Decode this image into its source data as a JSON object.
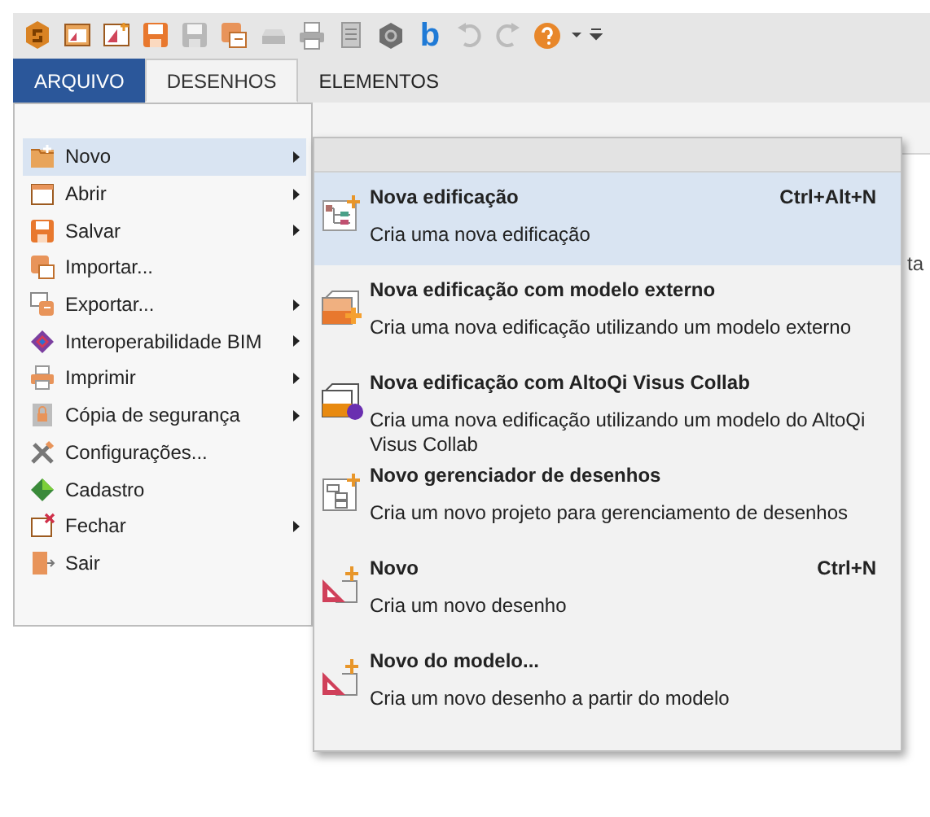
{
  "toolbar": {
    "text_button": "b"
  },
  "tabs": [
    {
      "label": "ARQUIVO",
      "kind": "file",
      "selected": false
    },
    {
      "label": "DESENHOS",
      "kind": "tab",
      "selected": true
    },
    {
      "label": "ELEMENTOS",
      "kind": "tab",
      "selected": false
    }
  ],
  "background_fragment": "ta",
  "file_menu": {
    "items": [
      {
        "label": "Novo",
        "submenu": true,
        "selected": true
      },
      {
        "label": "Abrir",
        "submenu": true,
        "selected": false
      },
      {
        "label": "Salvar",
        "submenu": true,
        "selected": false
      },
      {
        "label": "Importar...",
        "submenu": false,
        "selected": false
      },
      {
        "label": "Exportar...",
        "submenu": true,
        "selected": false
      },
      {
        "label": "Interoperabilidade BIM",
        "submenu": true,
        "selected": false
      },
      {
        "label": "Imprimir",
        "submenu": true,
        "selected": false
      },
      {
        "label": "Cópia de segurança",
        "submenu": true,
        "selected": false
      },
      {
        "label": "Configurações...",
        "submenu": false,
        "selected": false
      },
      {
        "label": "Cadastro",
        "submenu": false,
        "selected": false
      },
      {
        "label": "Fechar",
        "submenu": true,
        "selected": false
      },
      {
        "label": "Sair",
        "submenu": false,
        "selected": false
      }
    ]
  },
  "submenu": {
    "items": [
      {
        "title": "Nova edificação",
        "shortcut": "Ctrl+Alt+N",
        "description": "Cria uma nova edificação",
        "selected": true
      },
      {
        "title": "Nova edificação com modelo externo",
        "description": "Cria uma nova edificação utilizando um modelo externo",
        "selected": false
      },
      {
        "title": "Nova edificação com AltoQi Visus Collab",
        "description": "Cria uma nova edificação utilizando um modelo do AltoQi Visus Collab",
        "selected": false
      },
      {
        "title": "Novo gerenciador de desenhos",
        "description": "Cria um novo projeto para gerenciamento de desenhos",
        "selected": false
      },
      {
        "title": "Novo",
        "shortcut": "Ctrl+N",
        "description": "Cria um novo desenho",
        "selected": false
      },
      {
        "title": "Novo do modelo...",
        "description": "Cria um novo desenho a partir do modelo",
        "selected": false
      }
    ]
  }
}
